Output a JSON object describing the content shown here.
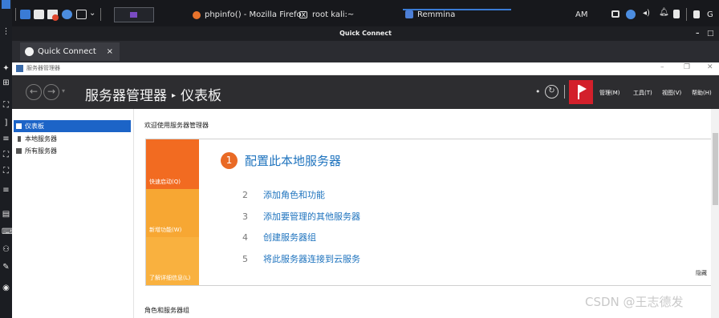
{
  "taskbar": {
    "firefox_title": "phpinfo() - Mozilla Firefox",
    "terminal_title": "root   kali:~",
    "remmina_title": "Remmina",
    "clock": "AM"
  },
  "remmina": {
    "window_title": "Quick Connect",
    "tab_label": "Quick Connect",
    "tab_close": "×",
    "minimize": "–",
    "maximize": "□"
  },
  "window": {
    "title": "服务器管理器",
    "minimize": "–",
    "restore": "❐",
    "close": "✕"
  },
  "header": {
    "back_icon": "back-arrow-icon",
    "forward_icon": "forward-arrow-icon",
    "breadcrumb_root": "服务器管理器",
    "breadcrumb_arrow": "▸",
    "breadcrumb_page": "仪表板",
    "menu": {
      "manage": "管理(M)",
      "tools": "工具(T)",
      "view": "视图(V)",
      "help": "帮助(H)"
    }
  },
  "sidebar": {
    "items": [
      {
        "label": "仪表板",
        "active": true
      },
      {
        "label": "本地服务器",
        "active": false
      },
      {
        "label": "所有服务器",
        "active": false
      }
    ]
  },
  "dashboard": {
    "welcome": "欢迎使用服务器管理器",
    "quick_start": "快速启动(Q)",
    "whats_new": "新增功能(W)",
    "learn_more": "了解详细信息(L)",
    "main_step_num": "1",
    "main_step": "配置此本地服务器",
    "steps": [
      {
        "num": "2",
        "label": "添加角色和功能"
      },
      {
        "num": "3",
        "label": "添加要管理的其他服务器"
      },
      {
        "num": "4",
        "label": "创建服务器组"
      },
      {
        "num": "5",
        "label": "将此服务器连接到云服务"
      }
    ],
    "hide": "隐藏",
    "roles_heading": "角色和服务器组"
  },
  "colors": {
    "header_bg": "#2d2d30",
    "active_nav": "#1c64c7",
    "quick_start": "#f26b21",
    "whats_new": "#f7a733",
    "learn_more": "#f9b13f",
    "link": "#1e73be",
    "flag": "#d3202b"
  },
  "watermark": "CSDN @王志德发"
}
